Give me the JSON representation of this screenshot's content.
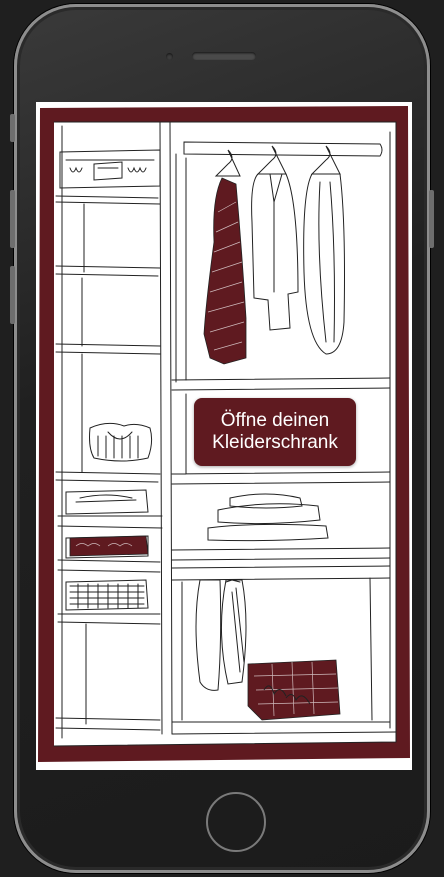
{
  "cta": {
    "line1": "Öffne deinen",
    "line2": "Kleiderschrank"
  },
  "colors": {
    "wardrobe_frame": "#5f1a20",
    "accent": "#5f1a20",
    "device_body": "#222222",
    "screen_bg": "#ffffff"
  },
  "icons": {
    "home_button": "home-button-icon",
    "camera": "camera-icon",
    "speaker": "speaker-grille-icon"
  }
}
